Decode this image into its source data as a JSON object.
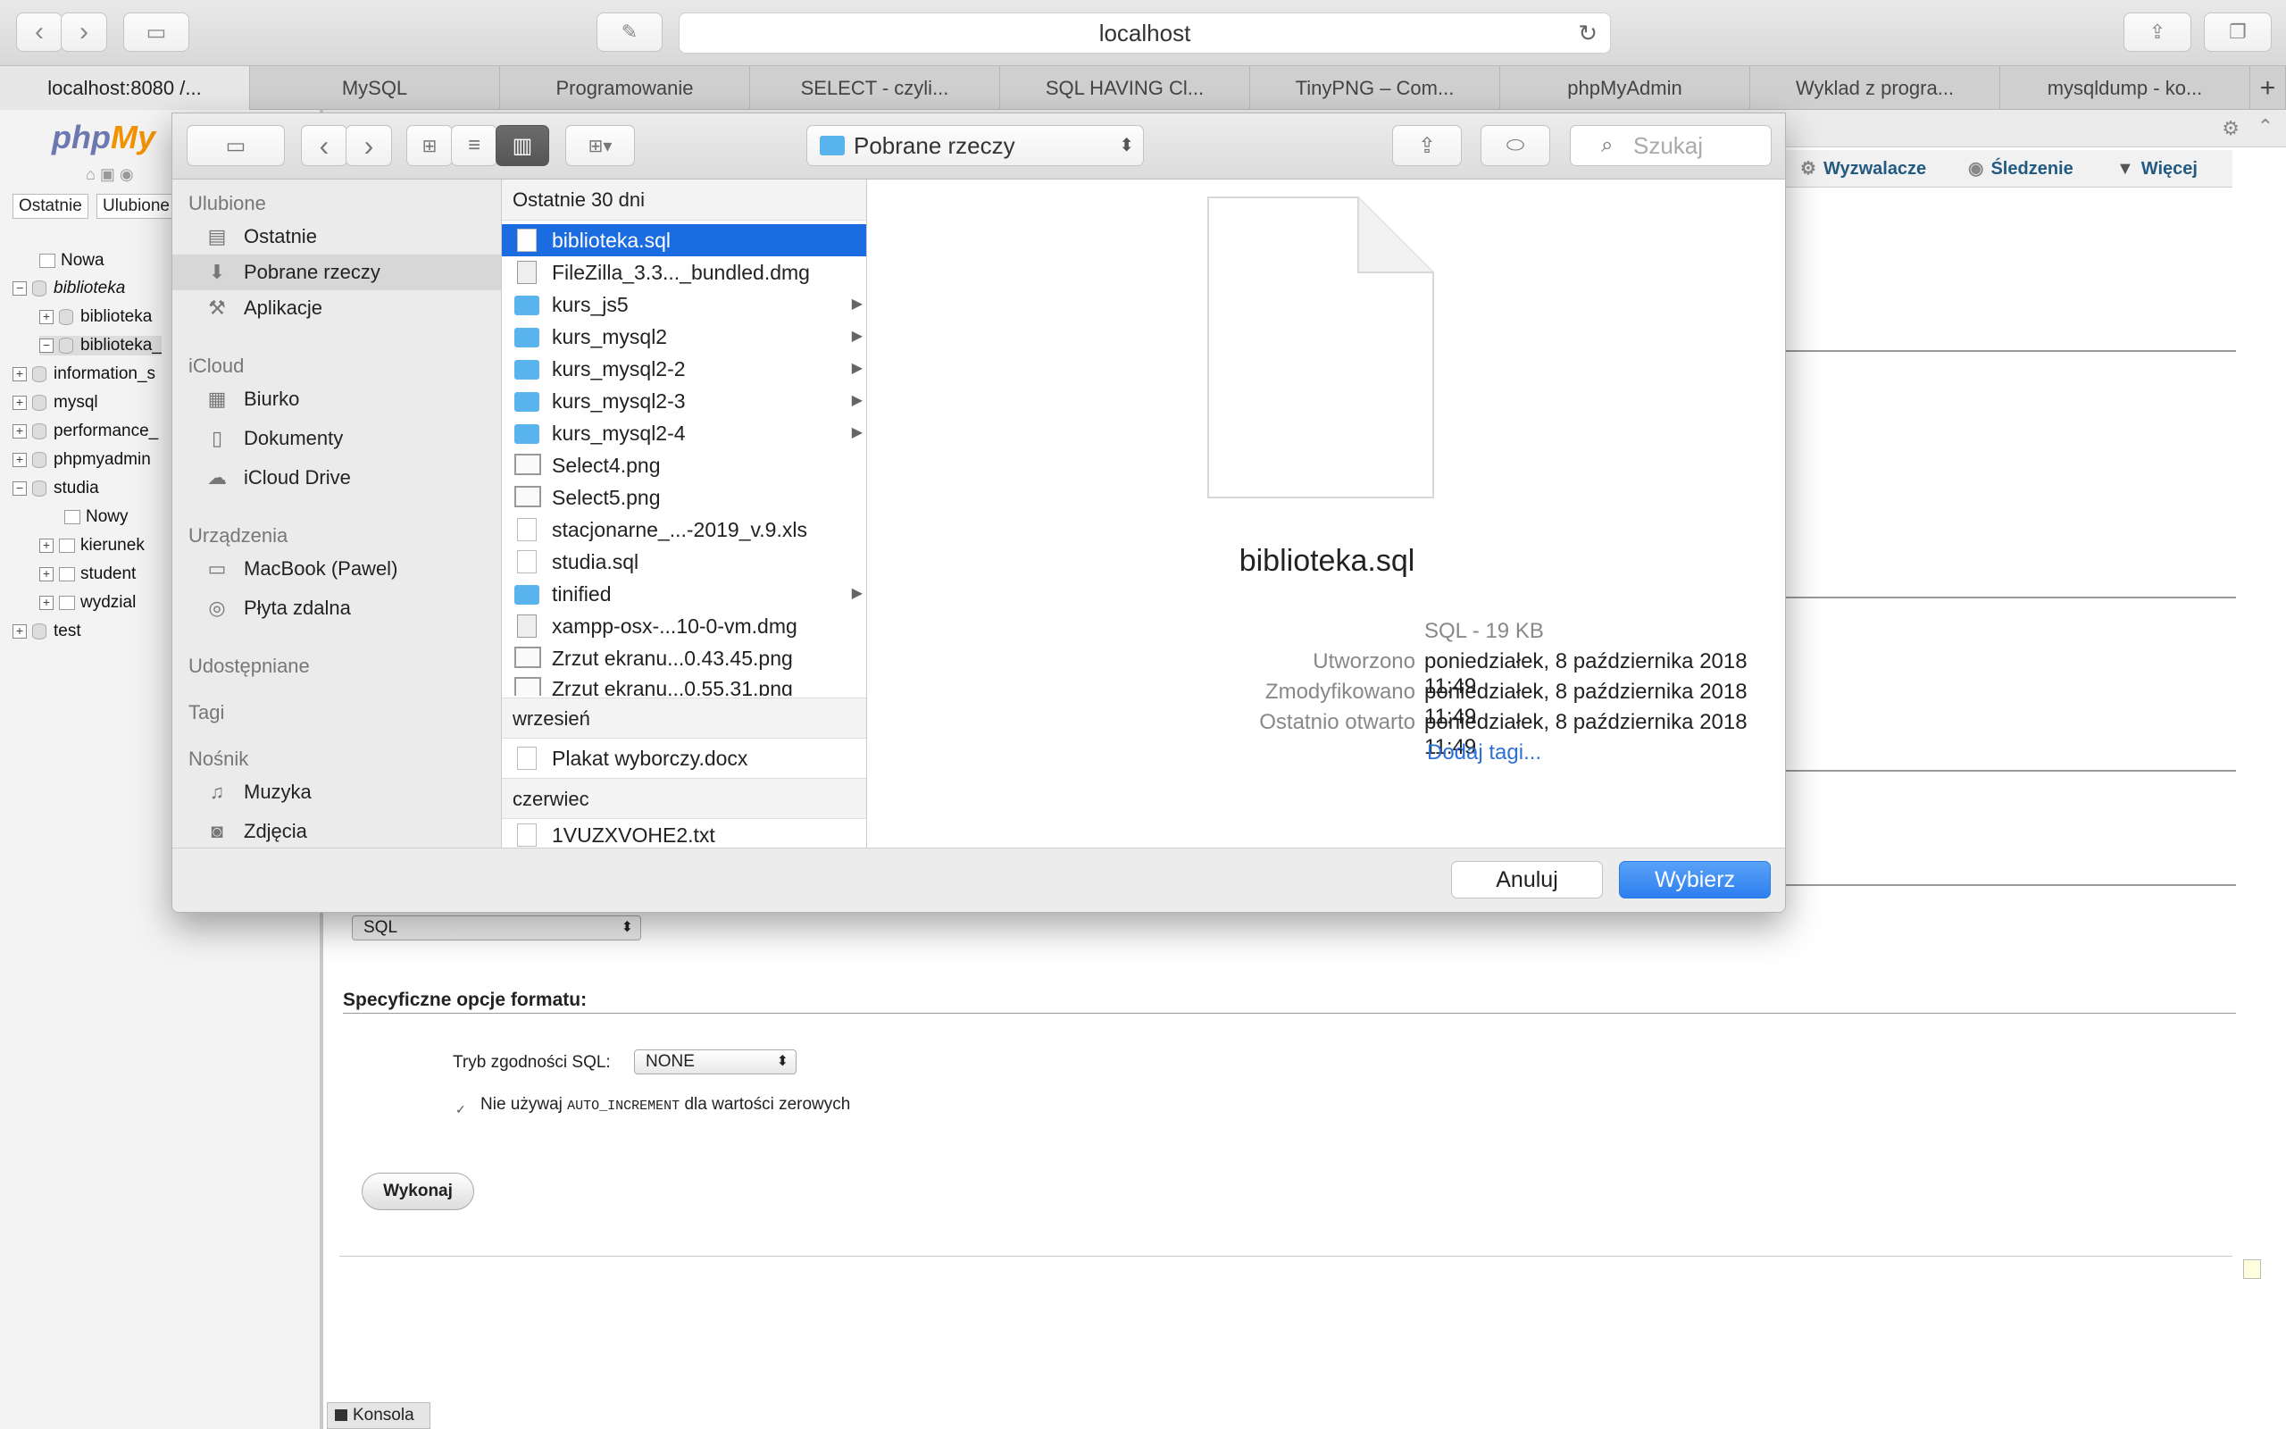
{
  "browser": {
    "url": "localhost",
    "tabs": [
      "localhost:8080 /...",
      "MySQL",
      "Programowanie",
      "SELECT - czyli...",
      "SQL HAVING Cl...",
      "TinyPNG – Com...",
      "phpMyAdmin",
      "Wyklad z progra...",
      "mysqldump - ko..."
    ],
    "new_tab": "+"
  },
  "pma": {
    "logo_a": "php",
    "logo_b": "My",
    "nav_tabs": [
      "Ostatnie",
      "Ulubione"
    ],
    "tree": [
      "Nowa",
      "biblioteka",
      "biblioteka",
      "biblioteka_",
      "information_s",
      "mysql",
      "performance_",
      "phpmyadmin",
      "studia",
      "Nowy",
      "kierunek",
      "student",
      "wydzial",
      "test"
    ],
    "top_tabs": [
      "Wyzwalacze",
      "Śledzenie",
      "Więcej"
    ],
    "format_value": "SQL",
    "section_title": "Specyficzne opcje formatu:",
    "compat_label": "Tryb zgodności SQL:",
    "compat_value": "NONE",
    "auto_inc_a": "Nie używaj",
    "auto_inc_code": "AUTO_INCREMENT",
    "auto_inc_b": "dla wartości zerowych",
    "execute": "Wykonaj",
    "console": "Konsola"
  },
  "dialog": {
    "location": "Pobrane rzeczy",
    "search_placeholder": "Szukaj",
    "sidebar": {
      "favorites_header": "Ulubione",
      "favorites": [
        "Ostatnie",
        "Pobrane rzeczy",
        "Aplikacje"
      ],
      "icloud_header": "iCloud",
      "icloud": [
        "Biurko",
        "Dokumenty",
        "iCloud Drive"
      ],
      "devices_header": "Urządzenia",
      "devices": [
        "MacBook (Pawel)",
        "Płyta zdalna"
      ],
      "shared_header": "Udostępniane",
      "tags_header": "Tagi",
      "media_header": "Nośnik",
      "media": [
        "Muzyka",
        "Zdjęcia"
      ]
    },
    "groups": [
      {
        "title": "Ostatnie 30 dni",
        "files": [
          "biblioteka.sql",
          "FileZilla_3.3..._bundled.dmg",
          "kurs_js5",
          "kurs_mysql2",
          "kurs_mysql2-2",
          "kurs_mysql2-3",
          "kurs_mysql2-4",
          "Select4.png",
          "Select5.png",
          "stacjonarne_...-2019_v.9.xls",
          "studia.sql",
          "tinified",
          "xampp-osx-...10-0-vm.dmg",
          "Zrzut ekranu...0.43.45.png",
          "Zrzut ekranu...0.55.31.png"
        ]
      },
      {
        "title": "wrzesień",
        "files": [
          "Plakat wyborczy.docx"
        ]
      },
      {
        "title": "czerwiec",
        "files": [
          "1VUZXVOHE2.txt"
        ]
      }
    ],
    "preview": {
      "name": "biblioteka.sql",
      "kind": "SQL - 19 KB",
      "created_label": "Utworzono",
      "created": "poniedziałek, 8 października 2018 11:49",
      "modified_label": "Zmodyfikowano",
      "modified": "poniedziałek, 8 października 2018 11:49",
      "opened_label": "Ostatnio otwarto",
      "opened": "poniedziałek, 8 października 2018 11:49",
      "add_tags": "Dodaj tagi..."
    },
    "cancel": "Anuluj",
    "choose": "Wybierz"
  }
}
